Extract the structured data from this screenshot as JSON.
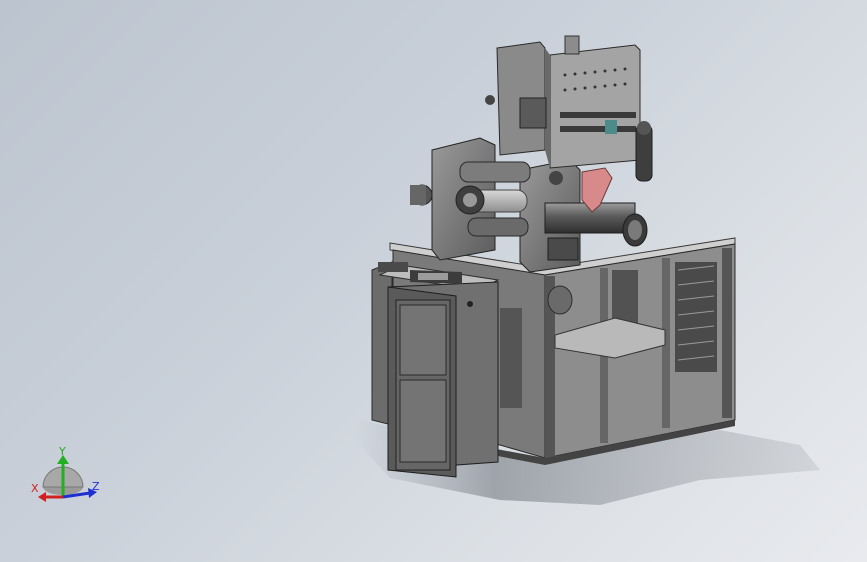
{
  "viewport": {
    "background_top": "#bcc4cf",
    "background_bottom": "#e8eaee"
  },
  "model": {
    "frame_color": "#6e6e6e",
    "panel_color": "#8a8a8a",
    "accent_color": "#d88a8a"
  },
  "triad": {
    "x_label": "X",
    "y_label": "Y",
    "z_label": "Z",
    "x_color": "#d02020",
    "y_color": "#20b020",
    "z_color": "#2030d0"
  }
}
